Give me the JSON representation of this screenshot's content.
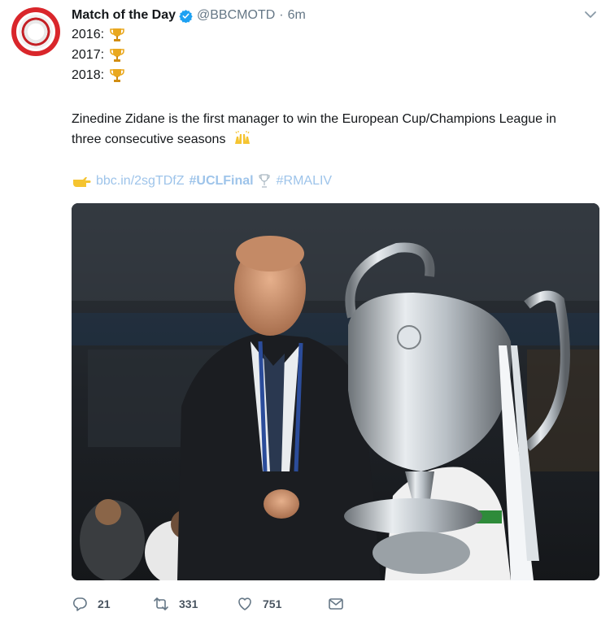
{
  "tweet": {
    "author_name": "Match of the Day",
    "handle": "@BBCMOTD",
    "separator": "·",
    "time": "6m",
    "years": [
      "2016:",
      "2017:",
      "2018:"
    ],
    "text": "Zinedine Zidane is the first manager to win the European Cup/Champions League in three consecutive seasons",
    "link": "bbc.in/2sgTDfZ",
    "hashtag_1": "#UCLFinal",
    "hashtag_2": "#RMALIV",
    "icons": {
      "avatar": "bbc-motd-logo",
      "verified": "verified-badge-icon",
      "more": "chevron-down-icon",
      "year_emoji": "trophy-icon",
      "hands_emoji": "raised-hands-icon",
      "pointer_emoji": "pointing-hand-icon",
      "hashtag_emoji": "trophy-outline-icon"
    }
  },
  "actions": {
    "replies": "21",
    "retweets": "331",
    "likes": "751"
  },
  "colors": {
    "link": "#9ec4ea",
    "verified": "#1da1f2",
    "muted": "#657786",
    "brand": "#d9262b"
  }
}
